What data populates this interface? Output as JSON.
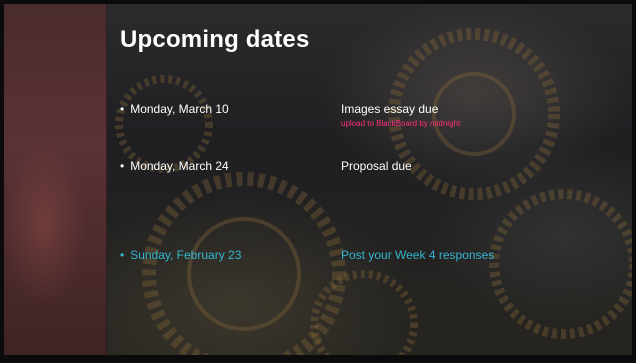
{
  "slide": {
    "title": "Upcoming dates",
    "items": [
      {
        "date": "Monday, March 10",
        "event": "Images essay due",
        "note": "upload to BlackBoard by midnight",
        "highlight": false
      },
      {
        "date": "Monday, March 24",
        "event": "Proposal due",
        "highlight": false
      },
      {
        "date": "Sunday, February 23",
        "event": "Post your Week 4 responses",
        "highlight": true
      }
    ]
  },
  "colors": {
    "text": "#ffffff",
    "highlight": "#34b6d0",
    "note": "#ff2f7a",
    "strip": "#5a3236"
  }
}
